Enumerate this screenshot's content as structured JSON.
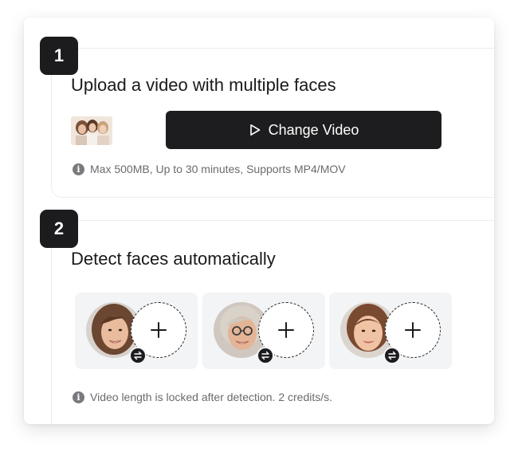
{
  "step1": {
    "number": "1",
    "title": "Upload a video with multiple faces",
    "change_video_label": "Change Video",
    "info": "Max 500MB, Up to 30 minutes, Supports MP4/MOV"
  },
  "step2": {
    "number": "2",
    "title": "Detect faces automatically",
    "info": "Video length is locked after detection. 2 credits/s.",
    "faces": [
      {
        "name": "face-woman-brunette",
        "add_label": "+"
      },
      {
        "name": "face-older-woman-glasses",
        "add_label": "+"
      },
      {
        "name": "face-young-woman",
        "add_label": "+"
      }
    ]
  },
  "icons": {
    "info": "info-icon",
    "play": "play-icon",
    "swap": "swap-icon",
    "add": "plus-icon"
  },
  "colors": {
    "accent_dark": "#1d1d1f",
    "face_card_bg": "#f3f4f6",
    "info_text": "#6b6b6f"
  }
}
